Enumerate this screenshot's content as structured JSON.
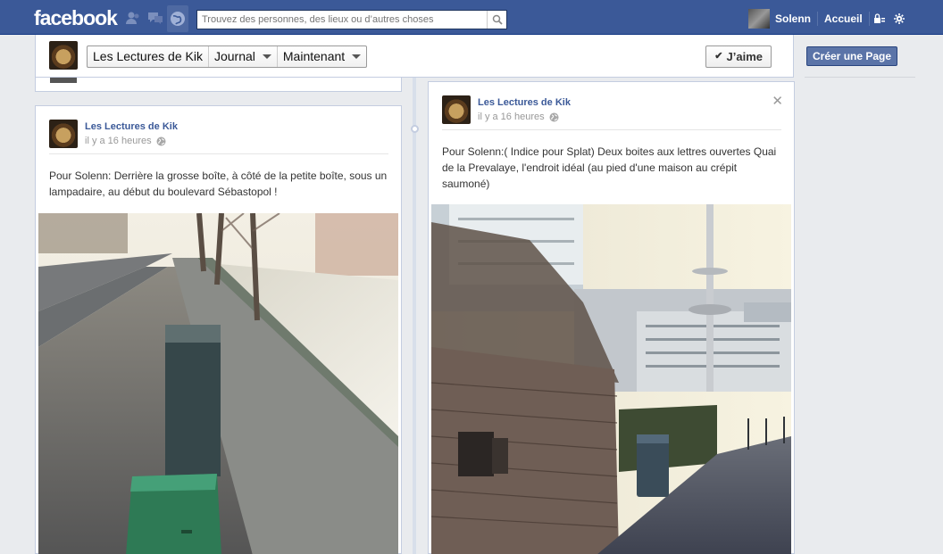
{
  "topbar": {
    "logo": "facebook",
    "search_placeholder": "Trouvez des personnes, des lieux ou d’autres choses",
    "user_name": "Solenn",
    "home_label": "Accueil",
    "icons": [
      "friend-requests-icon",
      "messages-icon",
      "notifications-icon",
      "search-icon",
      "privacy-icon",
      "settings-icon"
    ]
  },
  "page_header": {
    "crumbs": [
      "Les Lectures de Kik",
      "Journal",
      "Maintenant"
    ],
    "like_label": "J’aime"
  },
  "sidebar": {
    "create_page_label": "Créer une Page"
  },
  "posts": [
    {
      "author": "Les Lectures de Kik",
      "time": "il y a 16 heures",
      "text": "Pour Solenn: Derrière la grosse boîte, à côté de la petite boîte, sous un lampadaire, au début du boulevard Sébastopol !"
    },
    {
      "author": "Les Lectures de Kik",
      "time": "il y a 16 heures",
      "text": "Pour Solenn:( Indice pour Splat) Deux boites aux lettres ouvertes Quai de la Prevalaye, l'endroit idéal (au pied d'une maison au crépit saumoné)"
    }
  ],
  "colors": {
    "brand": "#3b5998",
    "link": "#3b5998",
    "background": "#e9ebee"
  }
}
